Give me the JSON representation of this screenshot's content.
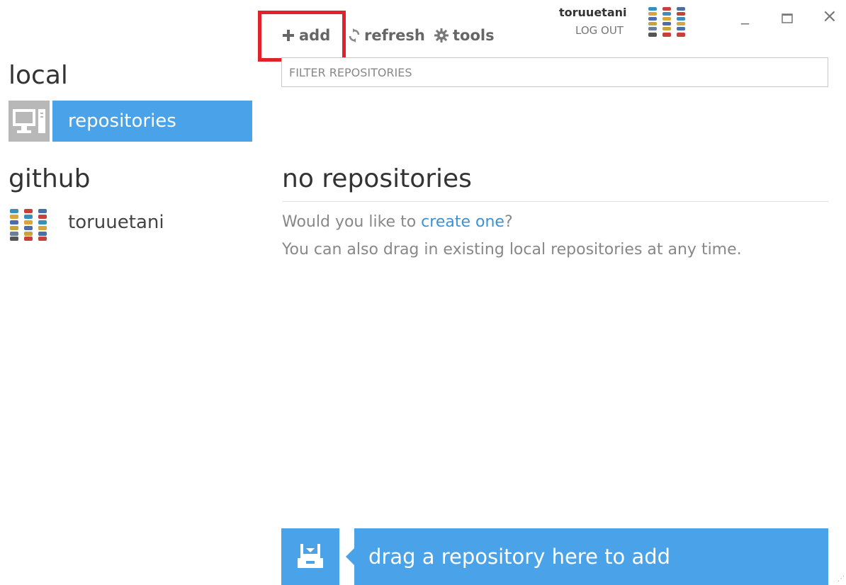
{
  "toolbar": {
    "add_label": "add",
    "refresh_label": "refresh",
    "tools_label": "tools"
  },
  "account": {
    "username": "toruuetani",
    "logout_label": "LOG OUT"
  },
  "window_controls": {
    "minimize": "_",
    "close": "×"
  },
  "filter": {
    "placeholder": "FILTER REPOSITORIES",
    "value": ""
  },
  "sidebar": {
    "local_title": "local",
    "local_item_label": "repositories",
    "github_title": "github",
    "github_user": "toruuetani"
  },
  "main": {
    "empty_title": "no repositories",
    "prompt_text": "Would you like to ",
    "create_link": "create one",
    "prompt_end": "?",
    "drag_hint": "You can also drag in existing local repositories at any time."
  },
  "dropzone": {
    "label": "drag a repository here to add"
  },
  "colors": {
    "accent": "#4aa3e8",
    "highlight": "#e2222a",
    "link": "#3a92d8"
  }
}
